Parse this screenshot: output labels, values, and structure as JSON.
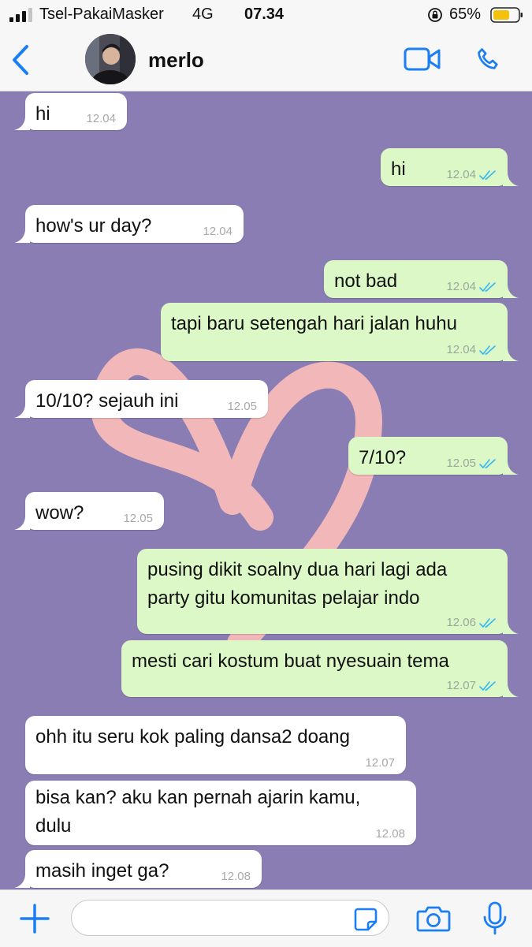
{
  "status_bar": {
    "carrier": "Tsel-PakaiMasker",
    "network": "4G",
    "time": "07.34",
    "battery_percent": "65%",
    "icons": [
      "signal-icon",
      "orientation-lock-icon",
      "battery-icon"
    ]
  },
  "header": {
    "contact_name": "merlo",
    "icons": [
      "back-icon",
      "video-call-icon",
      "voice-call-icon"
    ],
    "accent_color": "#1a7ef4"
  },
  "chat": {
    "background_color": "#8a7db3",
    "messages": [
      {
        "from": "contact",
        "text": "hi",
        "time": "12.04"
      },
      {
        "from": "me",
        "text": "hi",
        "time": "12.04",
        "read": true
      },
      {
        "from": "contact",
        "text": "how's ur day?",
        "time": "12.04"
      },
      {
        "from": "me",
        "text": "not bad",
        "time": "12.04",
        "read": true
      },
      {
        "from": "me",
        "text": "tapi baru setengah hari jalan huhu",
        "time": "12.04",
        "read": true
      },
      {
        "from": "contact",
        "text": "10/10? sejauh ini",
        "time": "12.05"
      },
      {
        "from": "me",
        "text": "7/10?",
        "time": "12.05",
        "read": true
      },
      {
        "from": "contact",
        "text": "wow?",
        "time": "12.05"
      },
      {
        "from": "me",
        "lines": [
          "pusing dikit soalny dua hari lagi ada",
          "party gitu komunitas pelajar indo"
        ],
        "time": "12.06",
        "read": true
      },
      {
        "from": "me",
        "text": "mesti cari kostum buat nyesuain tema",
        "time": "12.07",
        "read": true
      },
      {
        "from": "contact",
        "text": "ohh itu seru kok paling dansa2 doang",
        "time": "12.07"
      },
      {
        "from": "contact",
        "lines": [
          "bisa kan? aku kan pernah ajarin kamu,",
          "dulu"
        ],
        "time": "12.08"
      },
      {
        "from": "contact",
        "text": "masih inget ga?",
        "time": "12.08"
      }
    ]
  },
  "input_bar": {
    "placeholder": "",
    "icons": [
      "plus-icon",
      "sticker-icon",
      "camera-icon",
      "microphone-icon"
    ]
  }
}
